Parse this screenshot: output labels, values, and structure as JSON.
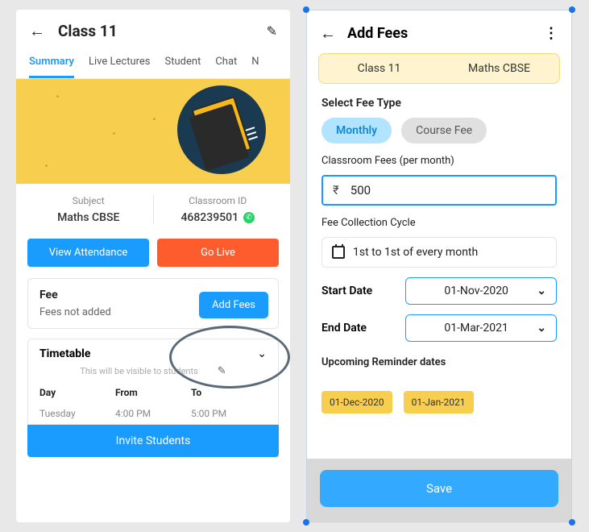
{
  "left": {
    "header": {
      "title": "Class 11"
    },
    "tabs": [
      "Summary",
      "Live Lectures",
      "Student",
      "Chat",
      "N"
    ],
    "info": {
      "subject_label": "Subject",
      "subject_value": "Maths CBSE",
      "id_label": "Classroom ID",
      "id_value": "468239501"
    },
    "buttons": {
      "attendance": "View Attendance",
      "golive": "Go Live"
    },
    "fee": {
      "title": "Fee",
      "status": "Fees not added",
      "add": "Add Fees"
    },
    "timetable": {
      "title": "Timetable",
      "note": "This will be visible to students",
      "cols": {
        "day": "Day",
        "from": "From",
        "to": "To"
      },
      "row": {
        "day": "Tuesday",
        "from": "4:00 PM",
        "to": "5:00 PM"
      },
      "invite": "Invite Students"
    }
  },
  "right": {
    "header": {
      "title": "Add Fees"
    },
    "classchips": {
      "a": "Class 11",
      "b": "Maths CBSE"
    },
    "feetype": {
      "label": "Select Fee Type",
      "monthly": "Monthly",
      "course": "Course Fee"
    },
    "amount": {
      "label": "Classroom Fees (per month)",
      "value": "500"
    },
    "cycle": {
      "label": "Fee Collection Cycle",
      "value": "1st to 1st of every month"
    },
    "dates": {
      "start_label": "Start Date",
      "start_value": "01-Nov-2020",
      "end_label": "End Date",
      "end_value": "01-Mar-2021"
    },
    "reminders": {
      "label": "Upcoming Reminder dates",
      "d1": "01-Dec-2020",
      "d2": "01-Jan-2021"
    },
    "save": "Save"
  }
}
